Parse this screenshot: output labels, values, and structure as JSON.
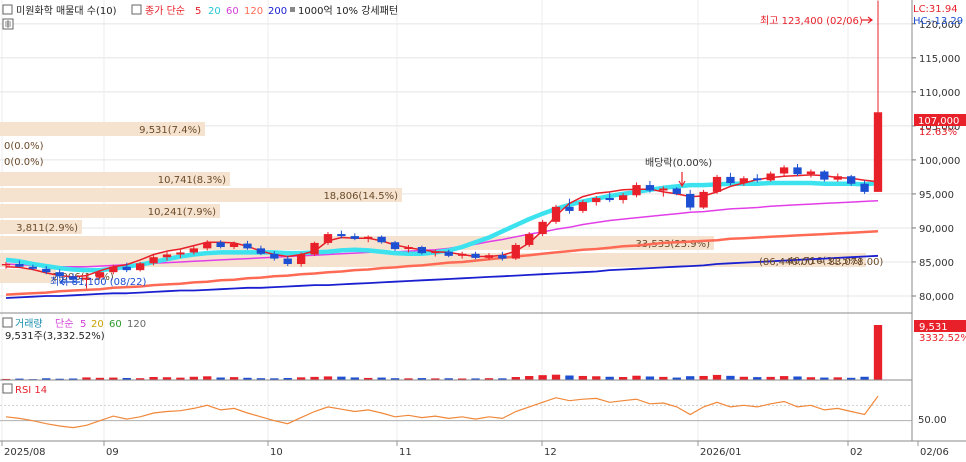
{
  "header": {
    "stock_label": "미원화학 매물대 수(10)",
    "close_label": "종가 단순",
    "ma_periods": [
      "5",
      "20",
      "60",
      "120",
      "200"
    ],
    "pattern_label": "1000억 10% 강세패턴",
    "lc_label": "LC:31.94",
    "hc_label": "HC:-13.29"
  },
  "price_panel": {
    "high_marker": "최고 123,400 (02/06)",
    "low_marker": "최저 81,100 (08/22)",
    "dividend_marker": "배당락(0.00%)",
    "current_price": "107,000",
    "current_change": "12.63%",
    "range_note": "(86,440.00 ~ 83,078.00)"
  },
  "volume_panel": {
    "title": "거래량",
    "ma_label": "단순",
    "ma_periods": [
      "5",
      "20",
      "60",
      "120"
    ],
    "current_volume_text": "9,531주(3,332.52%)",
    "current_volume": "9,531",
    "current_volume_pct": "3332.52%"
  },
  "rsi_panel": {
    "title": "RSI 14",
    "level_label": "50.00"
  },
  "x_axis": {
    "labels": [
      "2025/08",
      "09",
      "10",
      "11",
      "12",
      "2026/01",
      "02",
      "02/06"
    ]
  },
  "colors": {
    "up": "#e8202a",
    "down": "#1c4fd1",
    "ma5": "#e8202a",
    "ma20": "#3ce2ee",
    "ma60": "#e23ee8",
    "ma120": "#ff6a55",
    "ma200": "#1a1fd0",
    "volume_profile": "#f5e3cf",
    "rsi": "#f0883a"
  },
  "chart_data": [
    {
      "type": "candlestick",
      "title": "미원화학 매물대 수(10)",
      "y_axis_ticks": [
        80000,
        85000,
        90000,
        95000,
        100000,
        105000,
        110000,
        115000,
        120000
      ],
      "ylim": [
        77500,
        123500
      ],
      "high": {
        "value": 123400,
        "date": "02/06"
      },
      "low": {
        "value": 81100,
        "date": "08/22"
      },
      "last_close": 107000,
      "last_change_pct": 12.63,
      "series": [
        {
          "name": "5",
          "values": [
            84300,
            84200,
            83900,
            83400,
            83000,
            82800,
            83000,
            83700,
            84300,
            84600,
            85300,
            86100,
            86600,
            86900,
            87400,
            87900,
            87900,
            87800,
            87300,
            86600,
            86100,
            85800,
            86100,
            86600,
            88100,
            88600,
            88500,
            88500,
            88100,
            87500,
            87100,
            86800,
            86500,
            86400,
            86100,
            85800,
            85800,
            86000,
            86600,
            87800,
            89600,
            91800,
            93600,
            94600,
            95100,
            95300,
            95600,
            95700,
            95700,
            95300,
            95000,
            94600,
            94700,
            95300,
            96100,
            96600,
            97100,
            97400,
            97600,
            97700,
            97800,
            97700,
            97400,
            97300,
            97000,
            96800
          ]
        },
        {
          "name": "20",
          "values": [
            85300,
            85100,
            84700,
            84400,
            84100,
            83900,
            83800,
            83800,
            84000,
            84300,
            84600,
            85000,
            85400,
            85800,
            86100,
            86300,
            86400,
            86400,
            86400,
            86400,
            86400,
            86300,
            86300,
            86400,
            86500,
            86700,
            86800,
            86700,
            86500,
            86300,
            86200,
            86200,
            86400,
            86700,
            87200,
            87900,
            88600,
            89500,
            90400,
            91300,
            92100,
            92800,
            93400,
            93900,
            94300,
            94700,
            95000,
            95300,
            95600,
            95900,
            96100,
            96300,
            96300,
            96400,
            96500,
            96500,
            96500,
            96600,
            96600,
            96600,
            96600,
            96500,
            96500,
            96500,
            96400,
            96600
          ]
        },
        {
          "name": "60",
          "values": [
            84700,
            84600,
            84500,
            84400,
            84300,
            84300,
            84300,
            84400,
            84500,
            84600,
            84700,
            84800,
            84900,
            85000,
            85100,
            85200,
            85300,
            85400,
            85500,
            85600,
            85700,
            85800,
            85900,
            86000,
            86100,
            86200,
            86300,
            86400,
            86500,
            86500,
            86600,
            86700,
            86800,
            87000,
            87300,
            87600,
            88000,
            88300,
            88700,
            89100,
            89400,
            89800,
            90100,
            90500,
            90800,
            91100,
            91300,
            91500,
            91700,
            91900,
            92100,
            92300,
            92400,
            92600,
            92800,
            92900,
            93000,
            93200,
            93300,
            93400,
            93500,
            93600,
            93700,
            93800,
            93900,
            94000
          ]
        },
        {
          "name": "120",
          "values": [
            80200,
            80300,
            80400,
            80500,
            80700,
            80800,
            80900,
            81000,
            81200,
            81300,
            81400,
            81600,
            81700,
            81800,
            82000,
            82100,
            82300,
            82400,
            82600,
            82700,
            82900,
            83000,
            83200,
            83300,
            83500,
            83600,
            83800,
            83900,
            84100,
            84200,
            84400,
            84500,
            84700,
            84900,
            85000,
            85200,
            85400,
            85600,
            85800,
            86000,
            86200,
            86400,
            86600,
            86800,
            86900,
            87100,
            87300,
            87400,
            87600,
            87800,
            87900,
            88000,
            88100,
            88200,
            88400,
            88500,
            88600,
            88700,
            88800,
            88900,
            89000,
            89100,
            89200,
            89300,
            89400,
            89500
          ]
        },
        {
          "name": "200",
          "values": [
            79700,
            79800,
            79900,
            80000,
            80000,
            80100,
            80200,
            80300,
            80400,
            80400,
            80500,
            80600,
            80700,
            80800,
            80800,
            80900,
            81000,
            81100,
            81200,
            81200,
            81300,
            81400,
            81500,
            81600,
            81600,
            81700,
            81800,
            81900,
            82000,
            82100,
            82200,
            82300,
            82400,
            82500,
            82600,
            82700,
            82800,
            82900,
            83000,
            83100,
            83200,
            83300,
            83400,
            83500,
            83600,
            83800,
            83900,
            84000,
            84100,
            84200,
            84300,
            84400,
            84500,
            84700,
            84800,
            84900,
            85000,
            85100,
            85200,
            85300,
            85400,
            85500,
            85600,
            85700,
            85800,
            85900
          ]
        }
      ],
      "candles": [
        [
          84500,
          85000,
          84000,
          84700
        ],
        [
          84700,
          85200,
          84200,
          84300
        ],
        [
          84300,
          84600,
          83800,
          84000
        ],
        [
          84000,
          84400,
          83200,
          83500
        ],
        [
          83500,
          83900,
          82600,
          82900
        ],
        [
          82900,
          83300,
          82000,
          82400
        ],
        [
          82400,
          83200,
          81100,
          82700
        ],
        [
          82700,
          83800,
          82400,
          83500
        ],
        [
          83500,
          84600,
          83200,
          84300
        ],
        [
          84300,
          84900,
          83500,
          83800
        ],
        [
          83800,
          85000,
          83600,
          84800
        ],
        [
          84800,
          86000,
          84500,
          85700
        ],
        [
          85700,
          86500,
          85200,
          86100
        ],
        [
          86100,
          86800,
          85600,
          86400
        ],
        [
          86400,
          87300,
          86100,
          87000
        ],
        [
          87000,
          88200,
          86700,
          87900
        ],
        [
          87900,
          88200,
          87000,
          87200
        ],
        [
          87200,
          88000,
          86900,
          87700
        ],
        [
          87700,
          88100,
          86800,
          87000
        ],
        [
          87000,
          87400,
          86000,
          86200
        ],
        [
          86200,
          86600,
          85200,
          85500
        ],
        [
          85500,
          85900,
          84400,
          84700
        ],
        [
          84700,
          86400,
          84300,
          86100
        ],
        [
          86100,
          88000,
          85900,
          87800
        ],
        [
          87800,
          89400,
          87500,
          89100
        ],
        [
          89100,
          89600,
          88500,
          88800
        ],
        [
          88800,
          89200,
          88200,
          88400
        ],
        [
          88400,
          88900,
          87900,
          88700
        ],
        [
          88700,
          88900,
          87700,
          87900
        ],
        [
          87900,
          88100,
          86600,
          86900
        ],
        [
          86900,
          87500,
          86400,
          87200
        ],
        [
          87200,
          87400,
          86100,
          86300
        ],
        [
          86300,
          86800,
          85800,
          86500
        ],
        [
          86500,
          86800,
          85700,
          85900
        ],
        [
          85900,
          86500,
          85500,
          86200
        ],
        [
          86200,
          86500,
          85400,
          85600
        ],
        [
          85600,
          86300,
          85300,
          86000
        ],
        [
          86000,
          86500,
          85200,
          85500
        ],
        [
          85500,
          87800,
          85300,
          87500
        ],
        [
          87500,
          89400,
          87200,
          89100
        ],
        [
          89100,
          91200,
          88800,
          90900
        ],
        [
          90900,
          93400,
          90600,
          93100
        ],
        [
          93100,
          94300,
          92100,
          92500
        ],
        [
          92500,
          94100,
          92200,
          93800
        ],
        [
          93800,
          94700,
          93300,
          94400
        ],
        [
          94400,
          95200,
          93800,
          94100
        ],
        [
          94100,
          95100,
          93600,
          94800
        ],
        [
          94800,
          96700,
          94500,
          96300
        ],
        [
          96300,
          96900,
          95200,
          95500
        ],
        [
          95500,
          96100,
          94600,
          95800
        ],
        [
          95800,
          96000,
          94800,
          95000
        ],
        [
          95000,
          95600,
          92600,
          93000
        ],
        [
          93000,
          95600,
          92800,
          95300
        ],
        [
          95300,
          97800,
          95000,
          97500
        ],
        [
          97500,
          98100,
          96300,
          96600
        ],
        [
          96600,
          97600,
          96200,
          97300
        ],
        [
          97300,
          97900,
          96700,
          97000
        ],
        [
          97000,
          98300,
          96800,
          98000
        ],
        [
          98000,
          99200,
          97700,
          98900
        ],
        [
          98900,
          99400,
          97600,
          97900
        ],
        [
          97900,
          98600,
          97400,
          98300
        ],
        [
          98300,
          98500,
          96800,
          97100
        ],
        [
          97100,
          98000,
          96800,
          97600
        ],
        [
          97600,
          97800,
          96200,
          96500
        ],
        [
          96500,
          97000,
          95000,
          95300
        ],
        [
          95300,
          123400,
          95300,
          107000
        ]
      ]
    },
    {
      "type": "bar",
      "title": "거래량",
      "last_value": 9531,
      "last_change_pct": 3332.52,
      "values": [
        180,
        240,
        150,
        300,
        220,
        260,
        450,
        380,
        420,
        350,
        310,
        520,
        480,
        410,
        560,
        640,
        430,
        500,
        380,
        310,
        290,
        350,
        460,
        540,
        620,
        580,
        440,
        360,
        420,
        310,
        290,
        330,
        280,
        300,
        260,
        270,
        310,
        290,
        520,
        690,
        840,
        920,
        780,
        700,
        650,
        560,
        520,
        740,
        610,
        540,
        420,
        660,
        700,
        880,
        720,
        560,
        500,
        540,
        680,
        610,
        480,
        420,
        460,
        380,
        560,
        9531
      ]
    },
    {
      "type": "line",
      "title": "RSI 14",
      "yticks": [
        50
      ],
      "values": [
        55,
        53,
        50,
        46,
        43,
        41,
        44,
        50,
        56,
        52,
        55,
        60,
        62,
        63,
        66,
        70,
        64,
        66,
        60,
        55,
        50,
        46,
        54,
        62,
        68,
        65,
        62,
        64,
        60,
        55,
        57,
        54,
        56,
        53,
        55,
        52,
        55,
        53,
        62,
        68,
        74,
        80,
        76,
        78,
        79,
        74,
        76,
        78,
        72,
        73,
        68,
        58,
        68,
        74,
        68,
        70,
        68,
        72,
        75,
        68,
        70,
        64,
        66,
        62,
        58,
        82
      ]
    }
  ]
}
